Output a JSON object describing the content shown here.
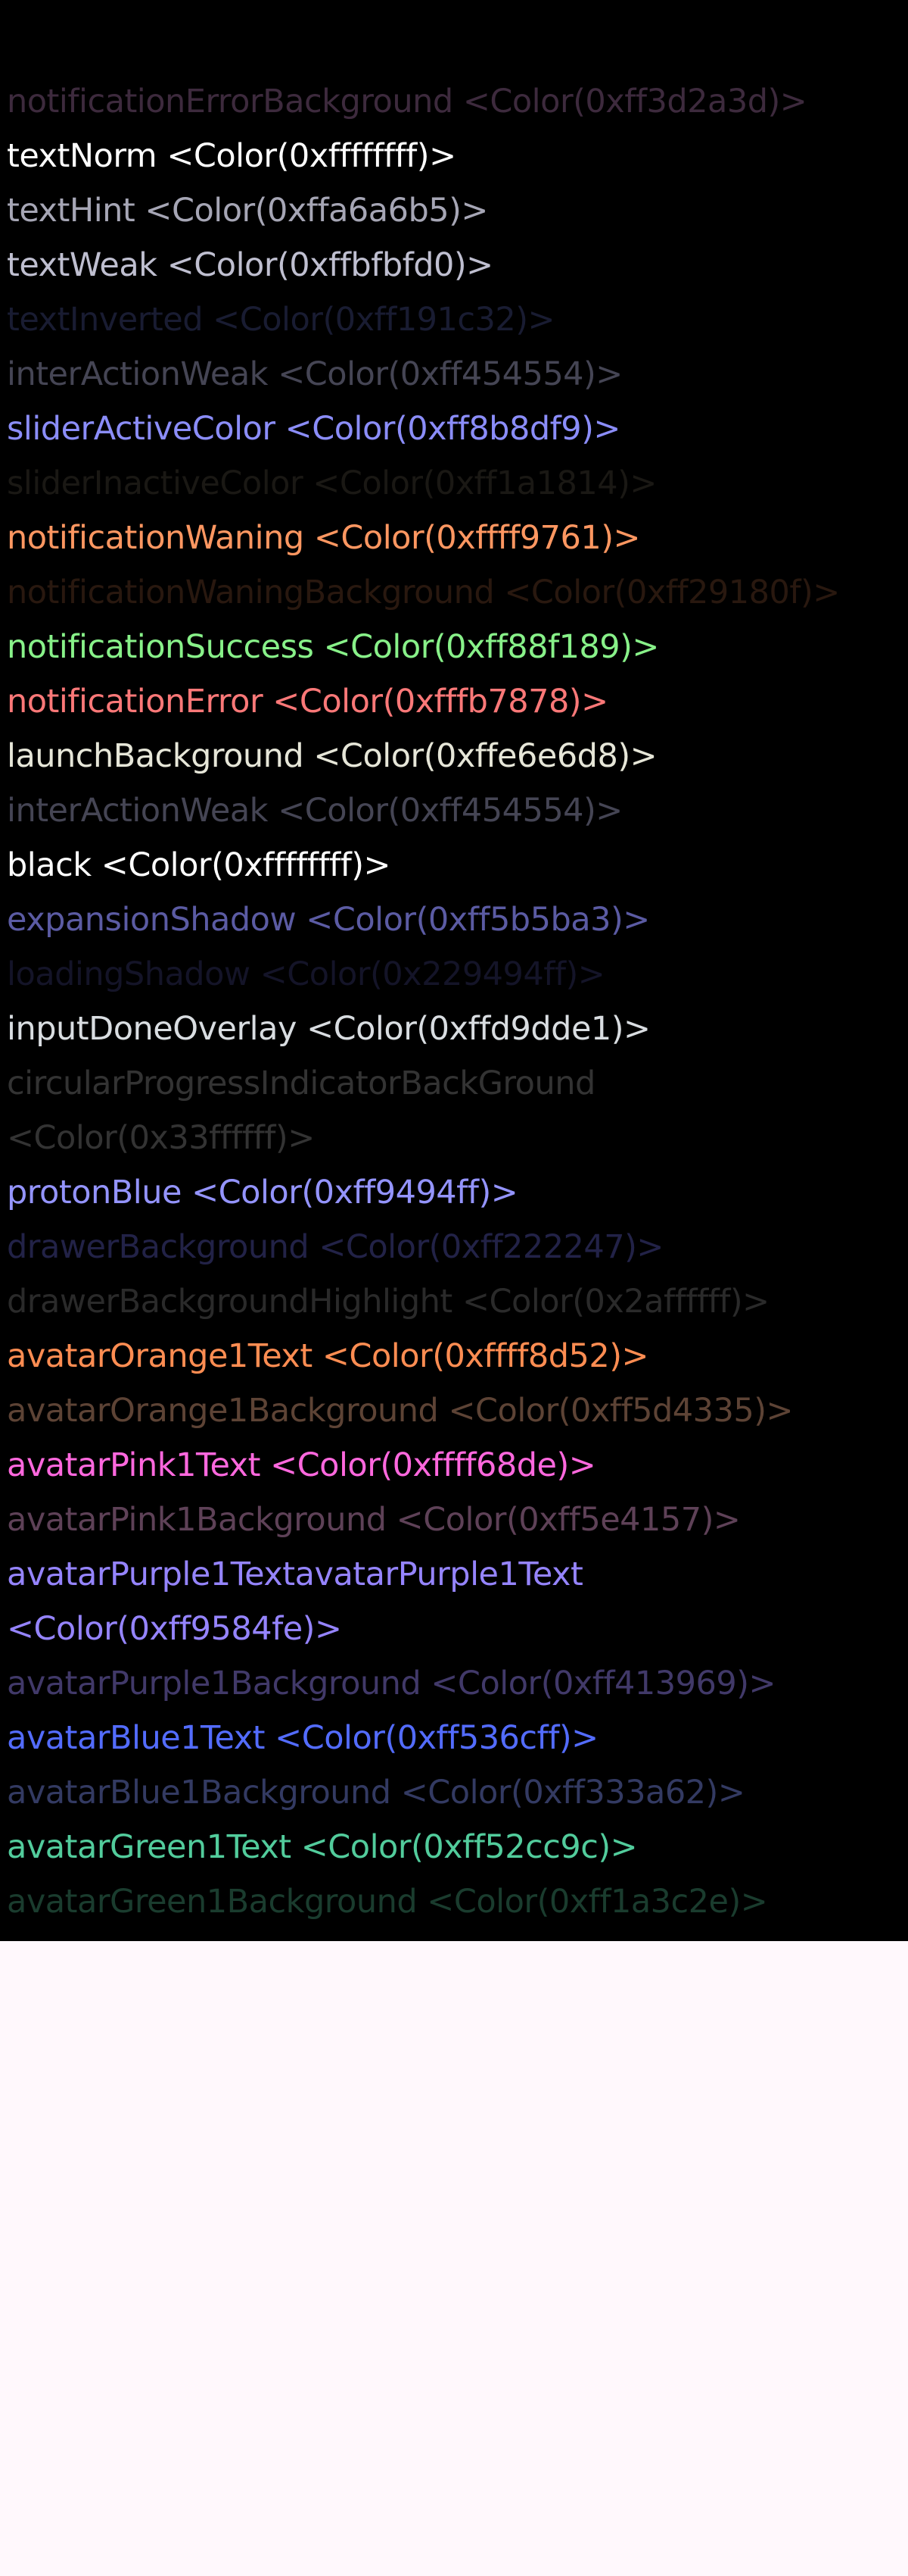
{
  "background": "#000000",
  "page_background": "#fff8fc",
  "rows": [
    {
      "text": "notificationErrorBackground <Color(0xff3d2a3d)>",
      "color": "#3d2a3d"
    },
    {
      "text": "textNorm <Color(0xffffffff)>",
      "color": "#ffffff"
    },
    {
      "text": "textHint <Color(0xffa6a6b5)>",
      "color": "#a6a6b5"
    },
    {
      "text": "textWeak <Color(0xffbfbfd0)>",
      "color": "#bfbfd0"
    },
    {
      "text": "textInverted <Color(0xff191c32)>",
      "color": "#191c32"
    },
    {
      "text": "interActionWeak <Color(0xff454554)>",
      "color": "#454554"
    },
    {
      "text": "sliderActiveColor <Color(0xff8b8df9)>",
      "color": "#8b8df9"
    },
    {
      "text": "sliderInactiveColor <Color(0xff1a1814)>",
      "color": "#1a1814"
    },
    {
      "text": "notificationWaning <Color(0xffff9761)>",
      "color": "#ff9761"
    },
    {
      "text": "notificationWaningBackground <Color(0xff29180f)>",
      "color": "#29180f"
    },
    {
      "text": "notificationSuccess <Color(0xff88f189)>",
      "color": "#88f189"
    },
    {
      "text": "notificationError <Color(0xfffb7878)>",
      "color": "#fb7878"
    },
    {
      "text": "launchBackground <Color(0xffe6e6d8)>",
      "color": "#e6e6d8"
    },
    {
      "text": "interActionWeak <Color(0xff454554)>",
      "color": "#454554"
    },
    {
      "text": "black <Color(0xffffffff)>",
      "color": "#ffffff"
    },
    {
      "text": "expansionShadow <Color(0xff5b5ba3)>",
      "color": "#5b5ba3"
    },
    {
      "text": "loadingShadow <Color(0x229494ff)>",
      "color": "#141428"
    },
    {
      "text": "inputDoneOverlay <Color(0xffd9dde1)>",
      "color": "#d9dde1"
    },
    {
      "text": "circularProgressIndicatorBackGround <Color(0x33ffffff)>",
      "color": "#333333",
      "wrap": true
    },
    {
      "text": "protonBlue <Color(0xff9494ff)>",
      "color": "#9494ff"
    },
    {
      "text": "drawerBackground <Color(0xff222247)>",
      "color": "#222247"
    },
    {
      "text": "drawerBackgroundHighlight <Color(0x2affffff)>",
      "color": "#2a2a2a"
    },
    {
      "text": "avatarOrange1Text <Color(0xffff8d52)>",
      "color": "#ff8d52"
    },
    {
      "text": "avatarOrange1Background <Color(0xff5d4335)>",
      "color": "#5d4335"
    },
    {
      "text": "avatarPink1Text <Color(0xffff68de)>",
      "color": "#ff68de"
    },
    {
      "text": "avatarPink1Background <Color(0xff5e4157)>",
      "color": "#5e4157"
    },
    {
      "text": "avatarPurple1TextavatarPurple1Text <Color(0xff9584fe)>",
      "color": "#9584fe",
      "wrap": true
    },
    {
      "text": "avatarPurple1Background <Color(0xff413969)>",
      "color": "#413969"
    },
    {
      "text": "avatarBlue1Text <Color(0xff536cff)>",
      "color": "#536cff"
    },
    {
      "text": "avatarBlue1Background <Color(0xff333a62)>",
      "color": "#333a62"
    },
    {
      "text": "avatarGreen1Text <Color(0xff52cc9c)>",
      "color": "#52cc9c"
    },
    {
      "text": "avatarGreen1Background <Color(0xff1a3c2e)>",
      "color": "#1a3c2e"
    }
  ]
}
